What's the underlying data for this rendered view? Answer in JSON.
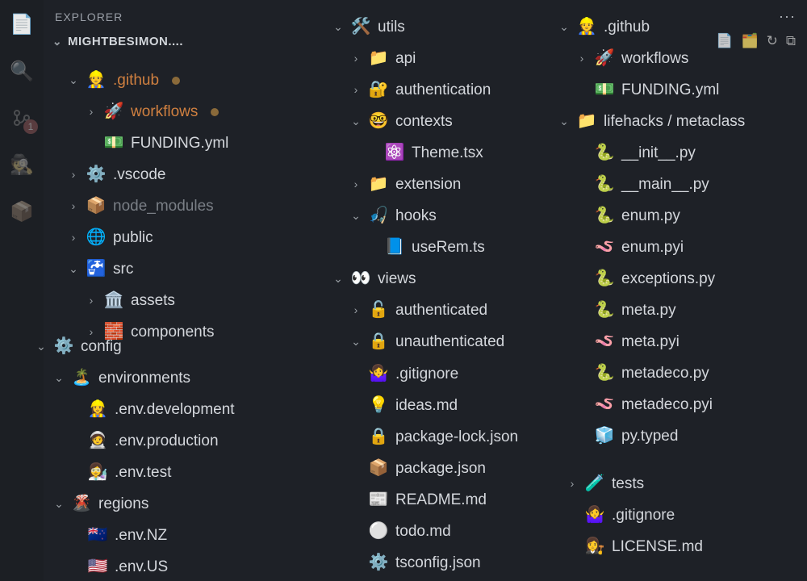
{
  "header": {
    "title": "EXPLORER"
  },
  "project": {
    "name": "MIGHTBESIMON...."
  },
  "badge_count": "1",
  "clusters": {
    "top_left": [
      {
        "chev": "down",
        "indent": 1,
        "emoji": "👷",
        "label": ".github",
        "style": "orange",
        "dot": true
      },
      {
        "chev": "right",
        "indent": 2,
        "emoji": "🚀",
        "label": "workflows",
        "style": "orange",
        "dot": true
      },
      {
        "chev": "blank",
        "indent": 2,
        "emoji": "💵",
        "label": "FUNDING.yml"
      },
      {
        "chev": "right",
        "indent": 1,
        "emoji": "⚙️",
        "label": ".vscode"
      },
      {
        "chev": "right",
        "indent": 1,
        "emoji": "📦",
        "label": "node_modules",
        "style": "muted"
      },
      {
        "chev": "right",
        "indent": 1,
        "emoji": "🌐",
        "label": "public"
      },
      {
        "chev": "down",
        "indent": 1,
        "emoji": "🚰",
        "label": "src"
      },
      {
        "chev": "right",
        "indent": 2,
        "emoji": "🏛️",
        "label": "assets"
      },
      {
        "chev": "right",
        "indent": 2,
        "emoji": "🧱",
        "label": "components"
      }
    ],
    "bot_left": [
      {
        "chev": "down",
        "indent": 1,
        "emoji": "⚙️",
        "label": "config"
      },
      {
        "chev": "down",
        "indent": 2,
        "emoji": "🏝️",
        "label": "environments"
      },
      {
        "chev": "blank",
        "indent": 3,
        "emoji": "👷‍♀️",
        "label": ".env.development"
      },
      {
        "chev": "blank",
        "indent": 3,
        "emoji": "🧑‍🚀",
        "label": ".env.production"
      },
      {
        "chev": "blank",
        "indent": 3,
        "emoji": "👩‍🔬",
        "label": ".env.test"
      },
      {
        "chev": "down",
        "indent": 2,
        "emoji": "🌋",
        "label": "regions"
      },
      {
        "chev": "blank",
        "indent": 3,
        "emoji": "🇳🇿",
        "label": ".env.NZ"
      },
      {
        "chev": "blank",
        "indent": 3,
        "emoji": "🇺🇸",
        "label": ".env.US"
      }
    ],
    "top_mid": [
      {
        "chev": "down",
        "indent": 1,
        "emoji": "🛠️",
        "label": "utils"
      },
      {
        "chev": "right",
        "indent": 2,
        "emoji": "📁",
        "label": "api"
      },
      {
        "chev": "right",
        "indent": 2,
        "emoji": "🔐",
        "label": "authentication"
      },
      {
        "chev": "down",
        "indent": 2,
        "emoji": "🤓",
        "label": "contexts"
      },
      {
        "chev": "blank",
        "indent": 3,
        "emoji": "⚛️",
        "label": "Theme.tsx"
      },
      {
        "chev": "right",
        "indent": 2,
        "emoji": "📁",
        "label": "extension"
      },
      {
        "chev": "down",
        "indent": 2,
        "emoji": "🎣",
        "label": "hooks"
      },
      {
        "chev": "blank",
        "indent": 3,
        "emoji": "📘",
        "label": "useRem.ts"
      },
      {
        "chev": "down",
        "indent": 1,
        "emoji": "👀",
        "label": "views"
      },
      {
        "chev": "right",
        "indent": 2,
        "emoji": "🔓",
        "label": "authenticated"
      },
      {
        "chev": "down",
        "indent": 2,
        "emoji": "🔒",
        "label": "unauthenticated"
      }
    ],
    "bot_mid": [
      {
        "chev": "blank",
        "indent": 2,
        "emoji": "🤷‍♀️",
        "label": ".gitignore"
      },
      {
        "chev": "blank",
        "indent": 2,
        "emoji": "💡",
        "label": "ideas.md"
      },
      {
        "chev": "blank",
        "indent": 2,
        "emoji": "🔒",
        "label": "package-lock.json"
      },
      {
        "chev": "blank",
        "indent": 2,
        "emoji": "📦",
        "label": "package.json"
      },
      {
        "chev": "blank",
        "indent": 2,
        "emoji": "📰",
        "label": "README.md"
      },
      {
        "chev": "blank",
        "indent": 2,
        "emoji": "⚪",
        "label": "todo.md"
      },
      {
        "chev": "blank",
        "indent": 2,
        "emoji": "⚙️",
        "label": "tsconfig.json"
      }
    ],
    "top_right": [
      {
        "chev": "down",
        "indent": 1,
        "emoji": "👷",
        "label": ".github"
      },
      {
        "chev": "right",
        "indent": 2,
        "emoji": "🚀",
        "label": "workflows"
      },
      {
        "chev": "blank",
        "indent": 2,
        "emoji": "💵",
        "label": "FUNDING.yml"
      },
      {
        "chev": "down",
        "indent": 1,
        "emoji": "📁",
        "label": "lifehacks / metaclass"
      },
      {
        "chev": "blank",
        "indent": 2,
        "emoji": "🐍",
        "label": "__init__.py"
      },
      {
        "chev": "blank",
        "indent": 2,
        "emoji": "🐍",
        "label": "__main__.py"
      },
      {
        "chev": "blank",
        "indent": 2,
        "emoji": "🐍",
        "label": "enum.py"
      },
      {
        "chev": "blank",
        "indent": 2,
        "emoji": "🪱",
        "label": "enum.pyi"
      },
      {
        "chev": "blank",
        "indent": 2,
        "emoji": "🐍",
        "label": "exceptions.py"
      },
      {
        "chev": "blank",
        "indent": 2,
        "emoji": "🐍",
        "label": "meta.py"
      },
      {
        "chev": "blank",
        "indent": 2,
        "emoji": "🪱",
        "label": "meta.pyi"
      },
      {
        "chev": "blank",
        "indent": 2,
        "emoji": "🐍",
        "label": "metadeco.py"
      },
      {
        "chev": "blank",
        "indent": 2,
        "emoji": "🪱",
        "label": "metadeco.pyi"
      },
      {
        "chev": "blank",
        "indent": 2,
        "emoji": "🧊",
        "label": "py.typed"
      }
    ],
    "bot_right": [
      {
        "chev": "right",
        "indent": 1,
        "emoji": "🧪",
        "label": "tests"
      },
      {
        "chev": "blank",
        "indent": 1,
        "emoji": "🤷‍♀️",
        "label": ".gitignore"
      },
      {
        "chev": "blank",
        "indent": 1,
        "emoji": "👩‍⚖️",
        "label": "LICENSE.md"
      }
    ]
  }
}
